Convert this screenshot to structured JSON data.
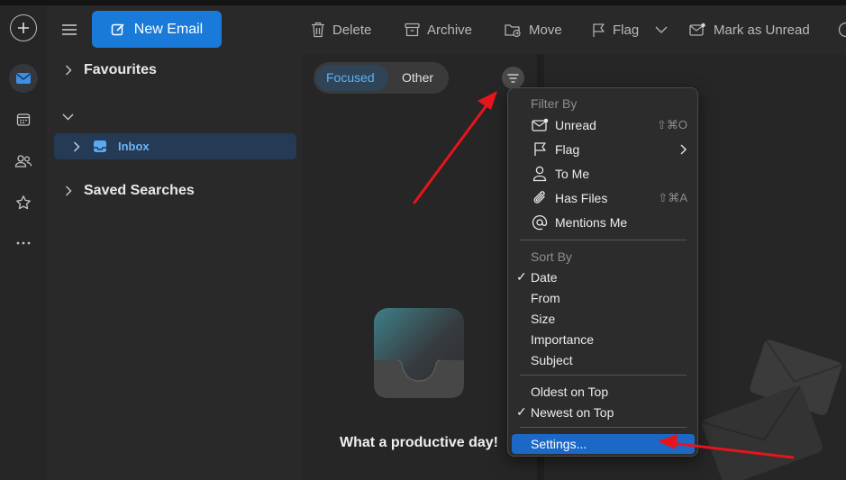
{
  "toolbar": {
    "new_email": "New Email",
    "delete": "Delete",
    "archive": "Archive",
    "move": "Move",
    "flag": "Flag",
    "mark_unread": "Mark as Unread"
  },
  "folders": {
    "favourites": "Favourites",
    "inbox": "Inbox",
    "saved_searches": "Saved Searches"
  },
  "message_list": {
    "tabs": [
      "Focused",
      "Other"
    ],
    "selected_tab": "Focused",
    "empty_title": "What a productive day!"
  },
  "filter_menu": {
    "filter_by_heading": "Filter By",
    "filter_items": [
      {
        "label": "Unread",
        "icon": "envelope-dot-icon",
        "shortcut": "⇧⌘O"
      },
      {
        "label": "Flag",
        "icon": "flag-icon",
        "submenu": true
      },
      {
        "label": "To Me",
        "icon": "person-icon"
      },
      {
        "label": "Has Files",
        "icon": "paperclip-icon",
        "shortcut": "⇧⌘A"
      },
      {
        "label": "Mentions Me",
        "icon": "at-icon"
      }
    ],
    "sort_by_heading": "Sort By",
    "sort_items": [
      {
        "label": "Date",
        "checked": true
      },
      {
        "label": "From"
      },
      {
        "label": "Size"
      },
      {
        "label": "Importance"
      },
      {
        "label": "Subject"
      }
    ],
    "order_items": [
      {
        "label": "Oldest on Top"
      },
      {
        "label": "Newest on Top",
        "checked": true
      }
    ],
    "settings": "Settings...",
    "check_mark": "✓"
  },
  "colors": {
    "accent": "#1a7ad9",
    "highlight": "#1b68c7",
    "annotation_arrow": "#e8141b"
  }
}
